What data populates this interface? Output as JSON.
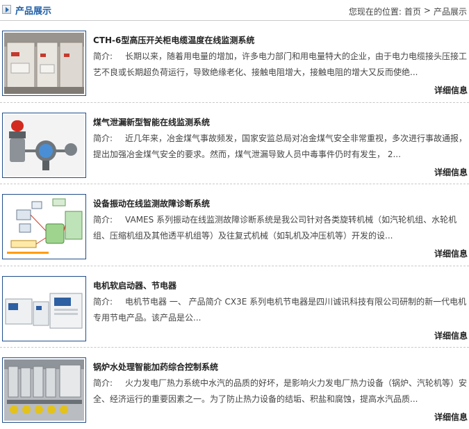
{
  "header": {
    "title": "产品展示",
    "breadcrumb": {
      "prefix": "您现在的位置:",
      "home": "首页",
      "sep": ">",
      "current": "产品展示"
    }
  },
  "products": [
    {
      "title": "CTH-6型高压开关柜电缆温度在线监测系统",
      "intro_label": "简介:",
      "description": "长期以来，随着用电量的增加，许多电力部门和用电量特大的企业，由于电力电缆接头压接工艺不良或长期超负荷运行，导致绝缘老化、接触电阻增大，接触电阻的增大又反而使绝...",
      "more_label": "详细信息",
      "image": "switchgear-cabinet-photo"
    },
    {
      "title": "煤气泄漏新型智能在线监测系统",
      "intro_label": "简介:",
      "description": "近几年来，冶金煤气事故频发，国家安监总局对冶金煤气安全非常重视，多次进行事故通报，提出加强冶金煤气安全的要求。然而，煤气泄漏导致人员中毒事件仍时有发生， 2...",
      "more_label": "详细信息",
      "image": "gas-detector-alarm-photo"
    },
    {
      "title": "设备振动在线监测故障诊断系统",
      "intro_label": "简介:",
      "description": "VAMES 系列振动在线监测故障诊断系统是我公司针对各类旋转机械（如汽轮机组、水轮机组、压缩机组及其他透平机组等）及往复式机械（如轧机及冲压机等）开发的设...",
      "more_label": "详细信息",
      "image": "vibration-system-diagram"
    },
    {
      "title": "电机软启动器、节电器",
      "intro_label": "简介:",
      "description": "电机节电器 一、 产品简介 CX3E 系列电机节电器是四川诚讯科技有限公司研制的新一代电机专用节电产品。该产品是公...",
      "more_label": "详细信息",
      "image": "motor-soft-starter-photo"
    },
    {
      "title": "锅炉水处理智能加药综合控制系统",
      "intro_label": "简介:",
      "description": "火力发电厂热力系统中水汽的品质的好坏，是影响火力发电厂热力设备（锅炉、汽轮机等）安全、经济运行的重要因素之一。为了防止热力设备的结垢、积盐和腐蚀，提高水汽品质...",
      "more_label": "详细信息",
      "image": "dosing-system-photo"
    }
  ]
}
